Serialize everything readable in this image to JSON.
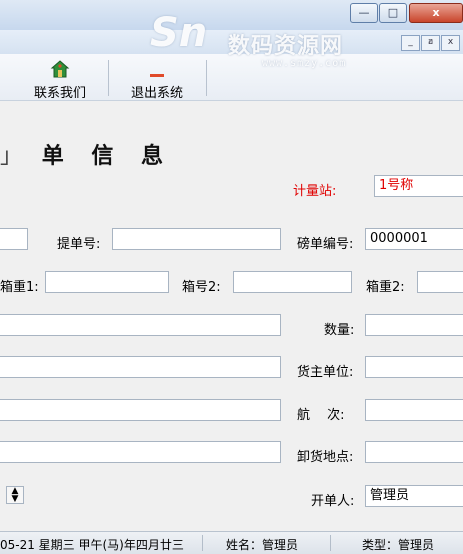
{
  "window": {
    "minimize": "—",
    "maximize": "□",
    "close": "x"
  },
  "watermark": {
    "logo": "Sn",
    "text": "数码资源网",
    "url": "www.smzy.com"
  },
  "mdi": {
    "minimize": "_",
    "restore": "ฮ",
    "close": "x"
  },
  "toolbar": {
    "contact_label": "联系我们",
    "exit_label": "退出系统"
  },
  "form": {
    "heading": "单 信 息",
    "heading_partial": "」",
    "station_label": "计量站:",
    "station_value": "1号称",
    "bill_no_label": "提单号:",
    "bill_no_value": "",
    "weigh_no_label": "磅单编号:",
    "weigh_no_value": "0000001",
    "box_weight1_label": "箱重1:",
    "box_weight1_value": "",
    "box_no2_label": "箱号2:",
    "box_no2_value": "",
    "box_weight2_label": "箱重2:",
    "box_weight2_value": "",
    "quantity_label": "数量:",
    "quantity_value": "",
    "owner_label": "货主单位:",
    "owner_value": "",
    "voyage_label": "航　 次:",
    "voyage_value": "",
    "unload_label": "卸货地点:",
    "unload_value": "",
    "issuer_label": "开单人:",
    "issuer_value": "管理员"
  },
  "status": {
    "date": "05-21 星期三 甲午(马)年四月廿三",
    "name": "姓名：管理员",
    "type": "类型：管理员"
  }
}
